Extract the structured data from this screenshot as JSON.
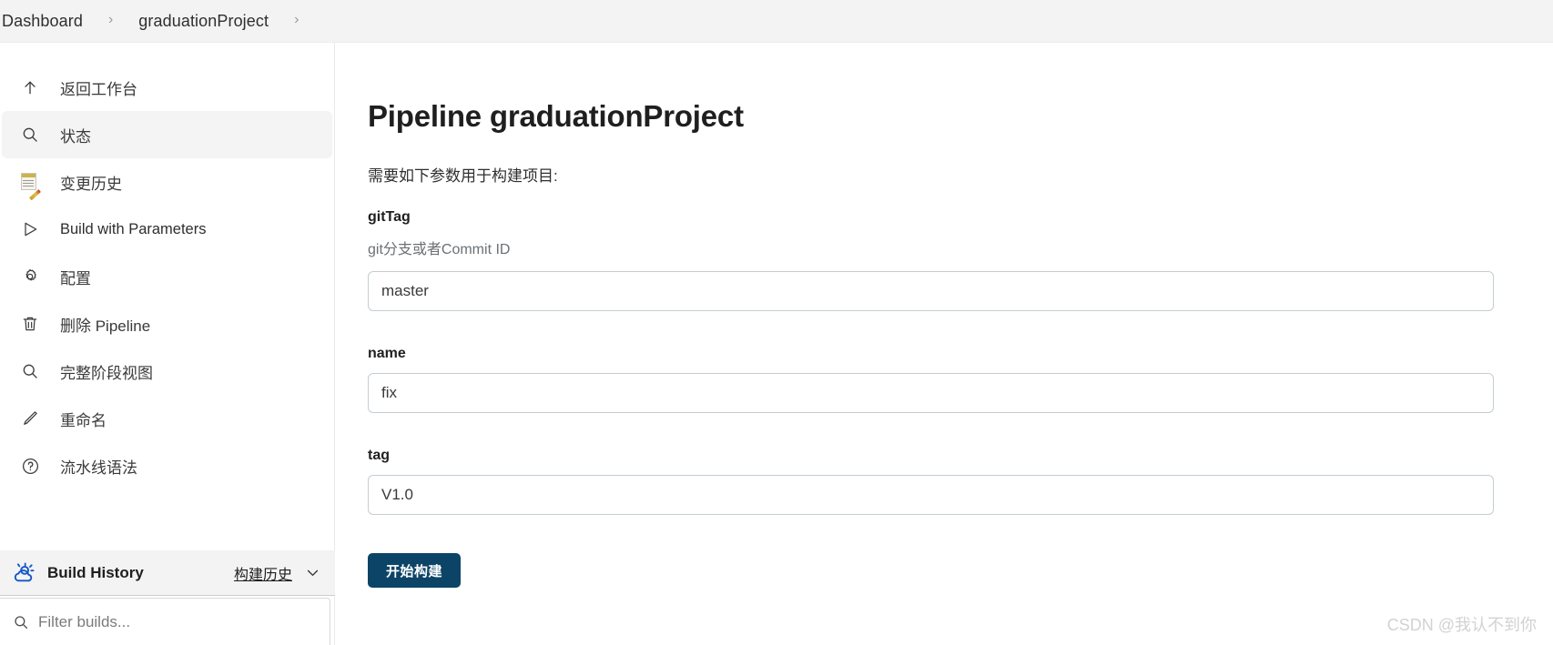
{
  "breadcrumb": {
    "items": [
      {
        "label": "Dashboard"
      },
      {
        "label": "graduationProject"
      }
    ],
    "separator": "›"
  },
  "sidebar": {
    "items": [
      {
        "label": "返回工作台",
        "icon": "arrow-up-icon",
        "active": false,
        "latin": false
      },
      {
        "label": "状态",
        "icon": "search-icon",
        "active": true,
        "latin": false
      },
      {
        "label": "变更历史",
        "icon": "change-history-icon",
        "active": false,
        "latin": false
      },
      {
        "label": "Build with Parameters",
        "icon": "play-icon",
        "active": false,
        "latin": true
      },
      {
        "label": "配置",
        "icon": "gear-icon",
        "active": false,
        "latin": false
      },
      {
        "label": "删除 Pipeline",
        "icon": "trash-icon",
        "active": false,
        "latin": false
      },
      {
        "label": "完整阶段视图",
        "icon": "search-icon",
        "active": false,
        "latin": false
      },
      {
        "label": "重命名",
        "icon": "pencil-icon",
        "active": false,
        "latin": false
      },
      {
        "label": "流水线语法",
        "icon": "question-circle-icon",
        "active": false,
        "latin": false
      }
    ],
    "build_history": {
      "title": "Build History",
      "link_label": "构建历史",
      "icon": "jenkins-weather-cloud-icon",
      "caret_icon": "chevron-down-icon"
    },
    "filter": {
      "placeholder": "Filter builds...",
      "value": "",
      "icon": "search-icon"
    }
  },
  "main": {
    "title": "Pipeline graduationProject",
    "intro": "需要如下参数用于构建项目:",
    "parameters": [
      {
        "name": "gitTag",
        "description": "git分支或者Commit ID",
        "value": "master",
        "placeholder": ""
      },
      {
        "name": "name",
        "description": "",
        "value": "fix",
        "placeholder": ""
      },
      {
        "name": "tag",
        "description": "",
        "value": "V1.0",
        "placeholder": ""
      }
    ],
    "submit_label": "开始构建"
  },
  "watermark": "CSDN @我认不到你",
  "colors": {
    "accent_button": "#0c4467",
    "breadcrumb_bg": "#f3f3f3",
    "active_nav_bg": "#f4f4f4",
    "input_border": "#c4cdd3",
    "jenkins_blue": "#1e5fbf"
  }
}
